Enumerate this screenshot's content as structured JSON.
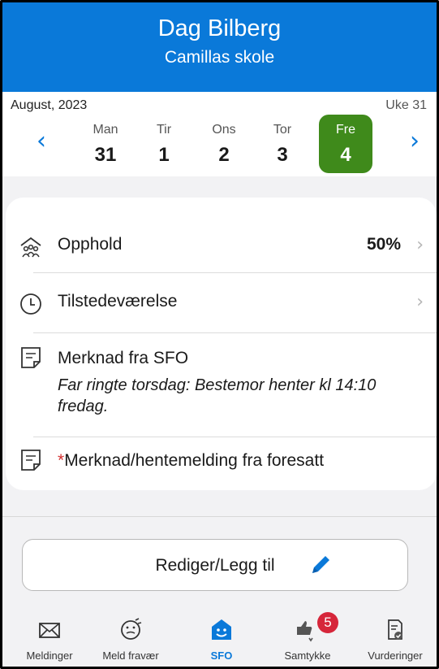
{
  "header": {
    "name": "Dag Bilberg",
    "school": "Camillas skole"
  },
  "calendar": {
    "month": "August, 2023",
    "week": "Uke 31",
    "prev_icon": "chevron-left-icon",
    "next_icon": "chevron-right-icon",
    "days": [
      {
        "name": "Man",
        "number": "31"
      },
      {
        "name": "Tir",
        "number": "1"
      },
      {
        "name": "Ons",
        "number": "2"
      },
      {
        "name": "Tor",
        "number": "3"
      },
      {
        "name": "Fre",
        "number": "4"
      }
    ],
    "selected_day": "Fre",
    "accent": "#3f8a1b"
  },
  "card": {
    "opphold": {
      "label": "Opphold",
      "value": "50%",
      "icon": "people-house-icon"
    },
    "tilstede": {
      "label": "Tilstedeværelse",
      "icon": "clock-icon"
    },
    "merknad_sfo": {
      "label": "Merknad fra SFO",
      "note": "Far ringte torsdag: Bestemor henter kl 14:10 fredag.",
      "icon": "note-icon"
    },
    "merknad_foresatt": {
      "required_mark": "*",
      "label": "Merknad/hentemelding fra foresatt",
      "icon": "note-icon"
    }
  },
  "edit_button": {
    "label": "Rediger/Legg til",
    "icon": "pencil-icon"
  },
  "tabs": [
    {
      "label": "Meldinger",
      "icon": "envelope-icon"
    },
    {
      "label": "Meld fravær",
      "icon": "sick-face-icon"
    },
    {
      "label": "SFO",
      "icon": "sfo-house-icon"
    },
    {
      "label": "Samtykke",
      "icon": "thumbs-icon",
      "badge": "5"
    },
    {
      "label": "Vurderinger",
      "icon": "assessment-icon"
    }
  ],
  "colors": {
    "primary": "#0a79d9",
    "badge": "#d6263a",
    "selected_day": "#3f8a1b"
  }
}
